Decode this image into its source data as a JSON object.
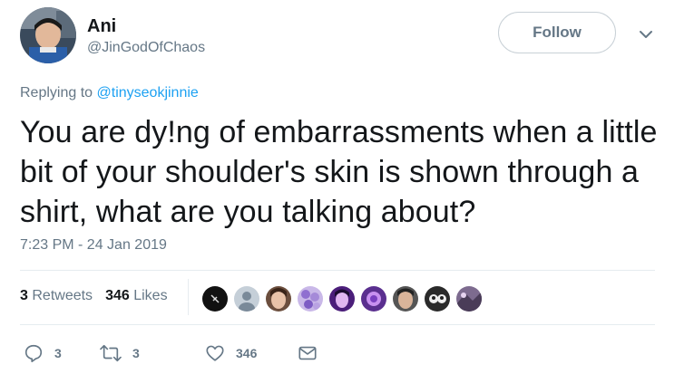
{
  "author": {
    "display_name": "Ani",
    "handle": "@JinGodOfChaos"
  },
  "follow_button": {
    "label": "Follow"
  },
  "reply": {
    "prefix": "Replying to ",
    "to": "@tinyseokjinnie"
  },
  "tweet": {
    "text": "You are dy!ng of embarrassments when a little bit of your shoulder's skin is shown through a shirt, what are you talking about?",
    "timestamp": "7:23 PM - 24 Jan 2019"
  },
  "stats": {
    "retweets_count": "3",
    "retweets_label": "Retweets",
    "likes_count": "346",
    "likes_label": "Likes"
  },
  "actions": {
    "reply_count": "3",
    "retweet_count": "3",
    "like_count": "346"
  },
  "colors": {
    "link": "#1da1f2",
    "secondary_text": "#657786",
    "primary_text": "#14171a"
  }
}
